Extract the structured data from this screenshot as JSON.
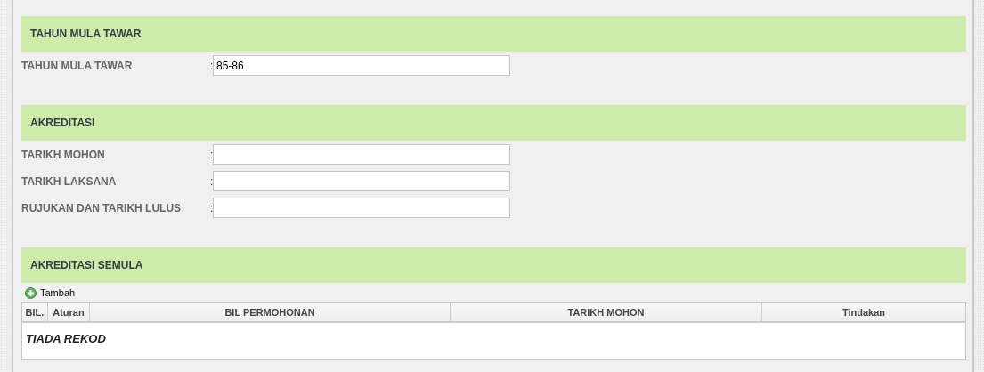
{
  "sections": [
    {
      "title": "TAHUN MULA TAWAR",
      "fields": [
        {
          "label": "TAHUN MULA TAWAR",
          "separator": ":",
          "value": "85-86"
        }
      ]
    },
    {
      "title": "AKREDITASI",
      "fields": [
        {
          "label": "TARIKH MOHON",
          "separator": ":"
        },
        {
          "label": "TARIKH LAKSANA",
          "separator": ":"
        },
        {
          "label": "RUJUKAN DAN TARIKH LULUS",
          "separator": ":"
        }
      ]
    },
    {
      "title": "AKREDITASI SEMULA",
      "add_button": "Tambah",
      "table": {
        "columns": [
          "BIL.",
          "Aturan",
          "BIL PERMOHONAN",
          "TARIKH MOHON",
          "Tindakan"
        ],
        "empty_text": "TIADA REKOD"
      }
    }
  ]
}
